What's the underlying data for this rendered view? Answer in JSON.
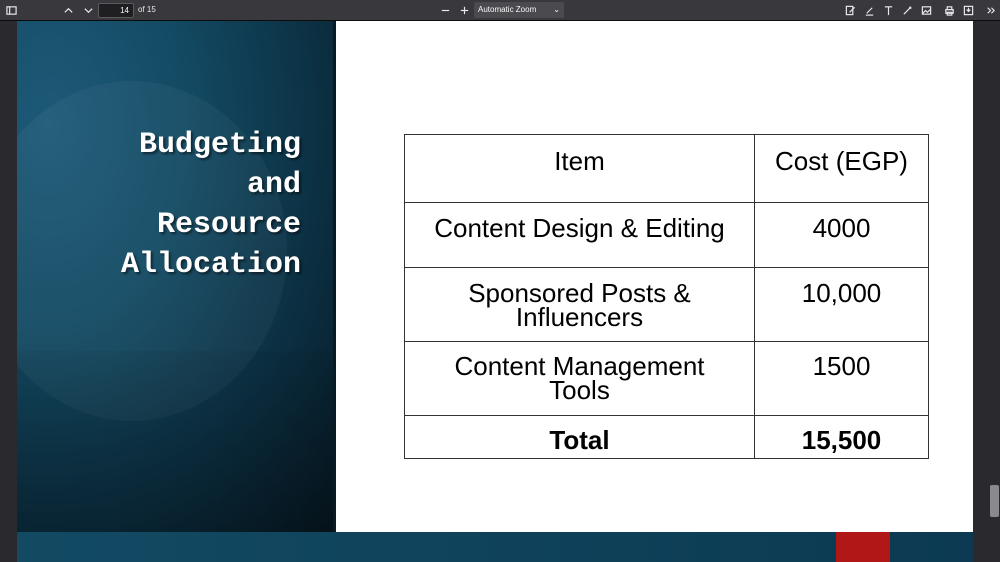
{
  "toolbar": {
    "page_number": "14",
    "page_count": "of 15",
    "zoom": "Automatic Zoom",
    "icons": [
      "sidebar-toggle-icon",
      "chevron-up-icon",
      "chevron-down-icon",
      "zoom-out-icon",
      "zoom-in-icon",
      "edit-file-icon",
      "highlight-icon",
      "text-icon",
      "draw-icon",
      "image-icon",
      "print-icon",
      "save-icon",
      "more-tools-icon"
    ]
  },
  "slide": {
    "title_lines": [
      "Budgeting",
      "and",
      "Resource",
      "Allocation"
    ],
    "table": {
      "headers": [
        "Item",
        "Cost (EGP)"
      ],
      "rows": [
        {
          "item_lines": [
            "Content Design & Editing"
          ],
          "cost": "4000"
        },
        {
          "item_lines": [
            "Sponsored Posts &",
            "Influencers"
          ],
          "cost": "10,000"
        },
        {
          "item_lines": [
            "Content Management",
            "Tools"
          ],
          "cost": "1500"
        }
      ],
      "total": {
        "label": "Total",
        "cost": "15,500"
      }
    }
  },
  "colors": {
    "toolbar_bg": "#38383d",
    "viewer_bg": "#2a2a2e",
    "slide_panel": "#134a63",
    "accent_red": "#b01818"
  }
}
